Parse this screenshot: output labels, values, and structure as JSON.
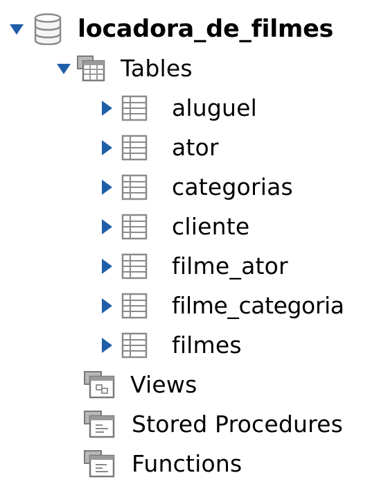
{
  "schema": {
    "name": "locadora_de_filmes",
    "icon": "database-icon",
    "expanded": true
  },
  "tables_node": {
    "label": "Tables",
    "icon": "tables-folder-icon",
    "expanded": true
  },
  "tables": [
    {
      "label": "aluguel",
      "icon": "table-icon"
    },
    {
      "label": "ator",
      "icon": "table-icon"
    },
    {
      "label": "categorias",
      "icon": "table-icon"
    },
    {
      "label": "cliente",
      "icon": "table-icon"
    },
    {
      "label": "filme_ator",
      "icon": "table-icon"
    },
    {
      "label": "filme_categoria",
      "icon": "table-icon"
    },
    {
      "label": "filmes",
      "icon": "table-icon"
    }
  ],
  "other_nodes": [
    {
      "label": "Views",
      "icon": "views-folder-icon"
    },
    {
      "label": "Stored Procedures",
      "icon": "stored-procedures-folder-icon"
    },
    {
      "label": "Functions",
      "icon": "functions-folder-icon"
    }
  ],
  "colors": {
    "expander_arrow": "#1f5fa8",
    "icon_gray": "#8a8a8a",
    "text": "#000000"
  }
}
